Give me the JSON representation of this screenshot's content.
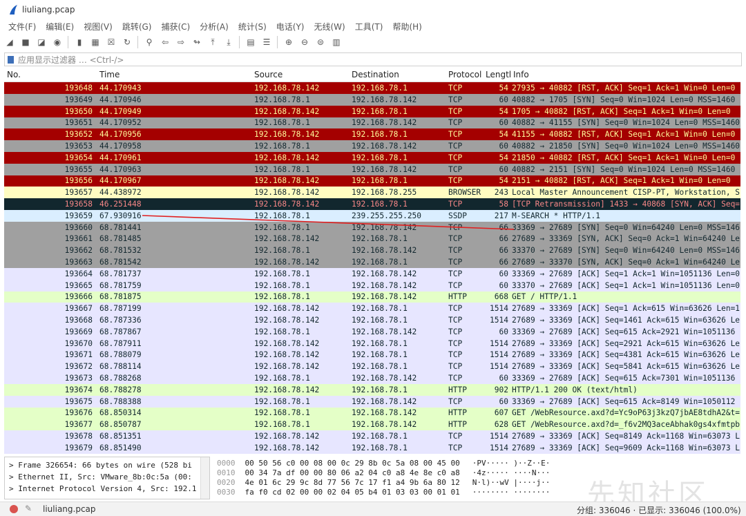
{
  "window": {
    "title": "liuliang.pcap"
  },
  "menu": [
    "文件(F)",
    "编辑(E)",
    "视图(V)",
    "跳转(G)",
    "捕获(C)",
    "分析(A)",
    "统计(S)",
    "电话(Y)",
    "无线(W)",
    "工具(T)",
    "帮助(H)"
  ],
  "toolbar": [
    {
      "name": "shark-fin-start-icon",
      "glyph": "◢"
    },
    {
      "name": "stop-capture-icon",
      "glyph": "■"
    },
    {
      "name": "restart-capture-icon",
      "glyph": "◪"
    },
    {
      "name": "capture-options-icon",
      "glyph": "◉"
    },
    {
      "name": "open-file-icon",
      "glyph": "▮"
    },
    {
      "name": "save-file-icon",
      "glyph": "▦"
    },
    {
      "name": "close-file-icon",
      "glyph": "☒"
    },
    {
      "name": "reload-icon",
      "glyph": "↻"
    },
    {
      "name": "find-packet-icon",
      "glyph": "⚲"
    },
    {
      "name": "go-back-icon",
      "glyph": "⇦"
    },
    {
      "name": "go-forward-icon",
      "glyph": "⇨"
    },
    {
      "name": "go-to-packet-icon",
      "glyph": "↬"
    },
    {
      "name": "first-packet-icon",
      "glyph": "⤒"
    },
    {
      "name": "last-packet-icon",
      "glyph": "⤓"
    },
    {
      "name": "autoscroll-icon",
      "glyph": "▤"
    },
    {
      "name": "colorize-icon",
      "glyph": "☰"
    },
    {
      "name": "zoom-in-icon",
      "glyph": "⊕"
    },
    {
      "name": "zoom-out-icon",
      "glyph": "⊖"
    },
    {
      "name": "normal-size-icon",
      "glyph": "⊜"
    },
    {
      "name": "resize-columns-icon",
      "glyph": "▥"
    }
  ],
  "filter": {
    "placeholder": "应用显示过滤器 … <Ctrl-/>"
  },
  "columns": {
    "no": "No.",
    "time": "Time",
    "source": "Source",
    "destination": "Destination",
    "protocol": "Protocol",
    "length": "Lengtl",
    "info": "Info"
  },
  "packets": [
    [
      "193648",
      "44.170943",
      "192.168.78.142",
      "192.168.78.1",
      "TCP",
      "54",
      "27935 → 40882 [RST, ACK] Seq=1 Ack=1 Win=0 Len=0",
      "rst"
    ],
    [
      "193649",
      "44.170946",
      "192.168.78.1",
      "192.168.78.142",
      "TCP",
      "60",
      "40882 → 1705 [SYN] Seq=0 Win=1024 Len=0 MSS=1460",
      "syn"
    ],
    [
      "193650",
      "44.170949",
      "192.168.78.142",
      "192.168.78.1",
      "TCP",
      "54",
      "1705 → 40882 [RST, ACK] Seq=1 Ack=1 Win=0 Len=0",
      "rst"
    ],
    [
      "193651",
      "44.170952",
      "192.168.78.1",
      "192.168.78.142",
      "TCP",
      "60",
      "40882 → 41155 [SYN] Seq=0 Win=1024 Len=0 MSS=1460",
      "syn"
    ],
    [
      "193652",
      "44.170956",
      "192.168.78.142",
      "192.168.78.1",
      "TCP",
      "54",
      "41155 → 40882 [RST, ACK] Seq=1 Ack=1 Win=0 Len=0",
      "rst"
    ],
    [
      "193653",
      "44.170958",
      "192.168.78.1",
      "192.168.78.142",
      "TCP",
      "60",
      "40882 → 21850 [SYN] Seq=0 Win=1024 Len=0 MSS=1460",
      "syn"
    ],
    [
      "193654",
      "44.170961",
      "192.168.78.142",
      "192.168.78.1",
      "TCP",
      "54",
      "21850 → 40882 [RST, ACK] Seq=1 Ack=1 Win=0 Len=0",
      "rst"
    ],
    [
      "193655",
      "44.170963",
      "192.168.78.1",
      "192.168.78.142",
      "TCP",
      "60",
      "40882 → 2151 [SYN] Seq=0 Win=1024 Len=0 MSS=1460",
      "syn"
    ],
    [
      "193656",
      "44.170967",
      "192.168.78.142",
      "192.168.78.1",
      "TCP",
      "54",
      "2151 → 40882 [RST, ACK] Seq=1 Ack=1 Win=0 Len=0",
      "rst"
    ],
    [
      "193657",
      "44.438972",
      "192.168.78.142",
      "192.168.78.255",
      "BROWSER",
      "243",
      "Local Master Announcement CISP-PT, Workstation, S",
      "browser"
    ],
    [
      "193658",
      "46.251448",
      "192.168.78.142",
      "192.168.78.1",
      "TCP",
      "58",
      "[TCP Retransmission] 1433 → 40868 [SYN, ACK] Seq=",
      "bad"
    ],
    [
      "193659",
      "67.930916",
      "192.168.78.1",
      "239.255.255.250",
      "SSDP",
      "217",
      "M-SEARCH * HTTP/1.1",
      "udp"
    ],
    [
      "193660",
      "68.781441",
      "192.168.78.1",
      "192.168.78.142",
      "TCP",
      "66",
      "33369 → 27689 [SYN] Seq=0 Win=64240 Len=0 MSS=146",
      "syn"
    ],
    [
      "193661",
      "68.781485",
      "192.168.78.142",
      "192.168.78.1",
      "TCP",
      "66",
      "27689 → 33369 [SYN, ACK] Seq=0 Ack=1 Win=64240 Le",
      "syn"
    ],
    [
      "193662",
      "68.781532",
      "192.168.78.1",
      "192.168.78.142",
      "TCP",
      "66",
      "33370 → 27689 [SYN] Seq=0 Win=64240 Len=0 MSS=146",
      "syn"
    ],
    [
      "193663",
      "68.781542",
      "192.168.78.142",
      "192.168.78.1",
      "TCP",
      "66",
      "27689 → 33370 [SYN, ACK] Seq=0 Ack=1 Win=64240 Le",
      "syn"
    ],
    [
      "193664",
      "68.781737",
      "192.168.78.1",
      "192.168.78.142",
      "TCP",
      "60",
      "33369 → 27689 [ACK] Seq=1 Ack=1 Win=1051136 Len=0",
      "tcp"
    ],
    [
      "193665",
      "68.781759",
      "192.168.78.1",
      "192.168.78.142",
      "TCP",
      "60",
      "33370 → 27689 [ACK] Seq=1 Ack=1 Win=1051136 Len=0",
      "tcp"
    ],
    [
      "193666",
      "68.781875",
      "192.168.78.1",
      "192.168.78.142",
      "HTTP",
      "668",
      "GET / HTTP/1.1",
      "http"
    ],
    [
      "193667",
      "68.787199",
      "192.168.78.142",
      "192.168.78.1",
      "TCP",
      "1514",
      "27689 → 33369 [ACK] Seq=1 Ack=615 Win=63626 Len=1",
      "tcp"
    ],
    [
      "193668",
      "68.787336",
      "192.168.78.142",
      "192.168.78.1",
      "TCP",
      "1514",
      "27689 → 33369 [ACK] Seq=1461 Ack=615 Win=63626 Le",
      "tcp"
    ],
    [
      "193669",
      "68.787867",
      "192.168.78.1",
      "192.168.78.142",
      "TCP",
      "60",
      "33369 → 27689 [ACK] Seq=615 Ack=2921 Win=1051136",
      "tcp"
    ],
    [
      "193670",
      "68.787911",
      "192.168.78.142",
      "192.168.78.1",
      "TCP",
      "1514",
      "27689 → 33369 [ACK] Seq=2921 Ack=615 Win=63626 Le",
      "tcp"
    ],
    [
      "193671",
      "68.788079",
      "192.168.78.142",
      "192.168.78.1",
      "TCP",
      "1514",
      "27689 → 33369 [ACK] Seq=4381 Ack=615 Win=63626 Le",
      "tcp"
    ],
    [
      "193672",
      "68.788114",
      "192.168.78.142",
      "192.168.78.1",
      "TCP",
      "1514",
      "27689 → 33369 [ACK] Seq=5841 Ack=615 Win=63626 Le",
      "tcp"
    ],
    [
      "193673",
      "68.788268",
      "192.168.78.1",
      "192.168.78.142",
      "TCP",
      "60",
      "33369 → 27689 [ACK] Seq=615 Ack=7301 Win=1051136",
      "tcp"
    ],
    [
      "193674",
      "68.788278",
      "192.168.78.142",
      "192.168.78.1",
      "HTTP",
      "902",
      "HTTP/1.1 200 OK  (text/html)",
      "http"
    ],
    [
      "193675",
      "68.788388",
      "192.168.78.1",
      "192.168.78.142",
      "TCP",
      "60",
      "33369 → 27689 [ACK] Seq=615 Ack=8149 Win=1050112",
      "tcp"
    ],
    [
      "193676",
      "68.850314",
      "192.168.78.1",
      "192.168.78.142",
      "HTTP",
      "607",
      "GET /WebResource.axd?d=Yc9oP63j3kzQ7jbAE8tdhA2&t=",
      "http"
    ],
    [
      "193677",
      "68.850787",
      "192.168.78.1",
      "192.168.78.142",
      "HTTP",
      "628",
      "GET /WebResource.axd?d=_f6v2MQ3aceAbhak0gs4xfmtpb",
      "http"
    ],
    [
      "193678",
      "68.851351",
      "192.168.78.142",
      "192.168.78.1",
      "TCP",
      "1514",
      "27689 → 33369 [ACK] Seq=8149 Ack=1168 Win=63073 L",
      "tcp"
    ],
    [
      "193679",
      "68.851490",
      "192.168.78.142",
      "192.168.78.1",
      "TCP",
      "1514",
      "27689 → 33369 [ACK] Seq=9609 Ack=1168 Win=63073 L",
      "tcp"
    ]
  ],
  "row_colors": {
    "rst": {
      "bg": "#a40000",
      "fg": "#fffc9c"
    },
    "syn": {
      "bg": "#a0a0a0",
      "fg": "#12272e"
    },
    "browser": {
      "bg": "#fffcc1",
      "fg": "#12272e"
    },
    "bad": {
      "bg": "#12272e",
      "fg": "#f78787"
    },
    "udp": {
      "bg": "#daeeff",
      "fg": "#12272e"
    },
    "tcp": {
      "bg": "#e7e6ff",
      "fg": "#12272e"
    },
    "http": {
      "bg": "#e4ffc7",
      "fg": "#12272e"
    }
  },
  "details": [
    "Frame 326654: 66 bytes on wire (528 bi",
    "Ethernet II, Src: VMware_8b:0c:5a (00:",
    "Internet Protocol Version 4, Src: 192.1"
  ],
  "hex": [
    {
      "off": "0000",
      "bytes": "00 50 56 c0 00 08 00 0c  29 8b 0c 5a 08 00 45 00",
      "ascii": "·PV·····  )··Z··E·"
    },
    {
      "off": "0010",
      "bytes": "00 34 7a df 00 00 80 06  a2 04 c0 a8 4e 8e c0 a8",
      "ascii": "·4z·····  ····N···"
    },
    {
      "off": "0020",
      "bytes": "4e 01 6c 29 9c 8d 77 56  7c 17 f1 a4 9b 6a 80 12",
      "ascii": "N·l)··wV  |····j··"
    },
    {
      "off": "0030",
      "bytes": "fa f0 cd 02 00 00 02 04  05 b4 01 03 03 00 01 01",
      "ascii": "········  ········"
    }
  ],
  "watermark": "先知社区",
  "status": {
    "file": "liuliang.pcap",
    "stats": "分组: 336046 · 已显示: 336046 (100.0%)"
  }
}
